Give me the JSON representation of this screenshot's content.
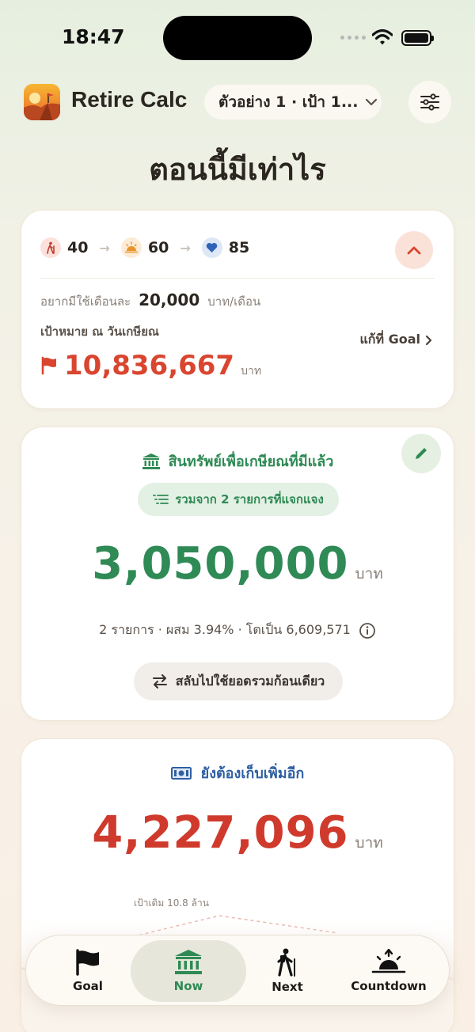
{
  "status_bar": {
    "time": "18:47"
  },
  "header": {
    "app_name": "Retire Calc",
    "scenario": "ตัวอย่าง 1 · เป้า 1...",
    "page_title": "ตอนนี้มีเท่าไร"
  },
  "goal_card": {
    "ages": {
      "current": "40",
      "retire": "60",
      "life": "85"
    },
    "monthly_label": "อยากมีใช้เดือนละ",
    "monthly_value": "20,000",
    "monthly_unit": "บาท/เดือน",
    "goal_label": "เป้าหมาย ณ วันเกษียณ",
    "goal_value": "10,836,667",
    "goal_unit": "บาท",
    "edit_goal": "แก้ที่ Goal"
  },
  "assets_card": {
    "title": "สินทรัพย์เพื่อเกษียณที่มีแล้ว",
    "breakdown_label": "รวมจาก 2 รายการที่แจกแจง",
    "total": "3,050,000",
    "unit": "บาท",
    "summary": "2 รายการ · ผสม 3.94% · โตเป็น 6,609,571",
    "switch_label": "สลับไปใช้ยอดรวมก้อนเดียว"
  },
  "need_card": {
    "title": "ยังต้องเก็บเพิ่มอีก",
    "amount": "4,227,096",
    "unit": "บาท",
    "old_goal_label": "เป้าเดิม 10.8 ล้าน"
  },
  "tabs": [
    {
      "label": "Goal",
      "icon": "flag-icon"
    },
    {
      "label": "Now",
      "icon": "bank-icon",
      "active": true
    },
    {
      "label": "Next",
      "icon": "hiker-icon"
    },
    {
      "label": "Countdown",
      "icon": "sunrise-icon"
    }
  ],
  "colors": {
    "green": "#2f8a55",
    "red": "#cf3a2c",
    "orange_red": "#d9452f",
    "blue": "#2f5fa3"
  }
}
